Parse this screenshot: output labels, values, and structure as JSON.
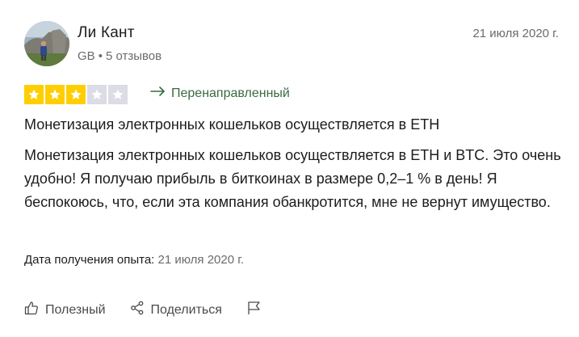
{
  "user": {
    "name": "Ли Кант",
    "country": "GB",
    "separator": "•",
    "reviews_count": "5 отзывов"
  },
  "review": {
    "date": "21 июля 2020 г.",
    "rating": 3,
    "rating_max": 5,
    "redirected_label": "Перенаправленный",
    "title": "Монетизация электронных кошельков осуществляется в ETH",
    "body": "Монетизация электронных кошельков осуществляется в ETH и BTC. Это очень удобно! Я получаю прибыль в биткоинах в размере 0,2–1 % в день! Я беспокоюсь, что, если эта компания обанкротится, мне не вернут имущество.",
    "experience_label": "Дата получения опыта:",
    "experience_date": "21 июля 2020 г."
  },
  "actions": {
    "helpful_label": "Полезный",
    "share_label": "Поделиться"
  },
  "colors": {
    "star_on": "#ffce00",
    "star_off": "#dcdce6",
    "redirect_green": "#3a6b3f",
    "muted_text": "#6b6b6b"
  },
  "icons": {
    "redirect": "arrow-right-icon",
    "helpful": "thumb-up-icon",
    "share": "share-icon",
    "flag": "flag-icon"
  }
}
